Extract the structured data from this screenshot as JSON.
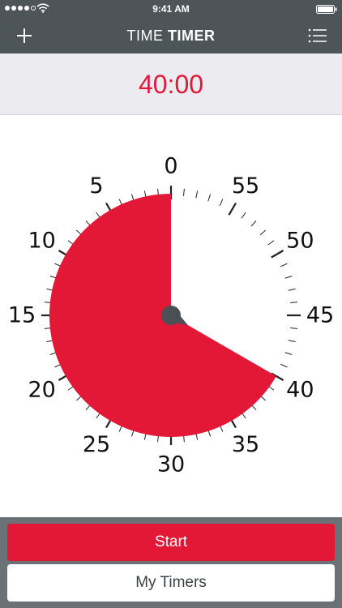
{
  "status_bar": {
    "time": "9:41 AM"
  },
  "nav": {
    "title_light": "TIME ",
    "title_bold": "TIMER"
  },
  "timer": {
    "display": "40:00",
    "set_minutes": 40
  },
  "dial": {
    "labels": [
      "0",
      "5",
      "10",
      "15",
      "20",
      "25",
      "30",
      "35",
      "40",
      "45",
      "50",
      "55"
    ]
  },
  "buttons": {
    "start_label": "Start",
    "my_timers_label": "My Timers"
  },
  "colors": {
    "accent": "#e31837",
    "bar": "#4e5559",
    "hand": "#4a5155"
  }
}
